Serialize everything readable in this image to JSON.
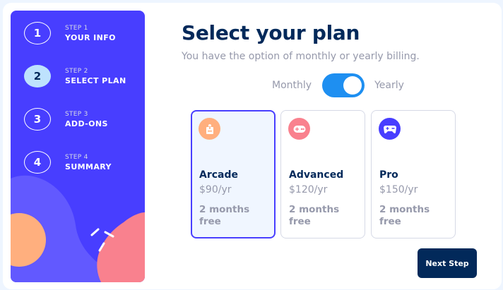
{
  "sidebar": {
    "steps": [
      {
        "number": "1",
        "sub": "STEP 1",
        "label": "YOUR INFO",
        "active": false
      },
      {
        "number": "2",
        "sub": "STEP 2",
        "label": "SELECT PLAN",
        "active": true
      },
      {
        "number": "3",
        "sub": "STEP 3",
        "label": "ADD-ONS",
        "active": false
      },
      {
        "number": "4",
        "sub": "STEP 4",
        "label": "SUMMARY",
        "active": false
      }
    ]
  },
  "main": {
    "title": "Select your plan",
    "subtitle": "You have the option of monthly or yearly billing.",
    "billing": {
      "monthly_label": "Monthly",
      "yearly_label": "Yearly",
      "selected": "Yearly"
    },
    "plans": [
      {
        "name": "Arcade",
        "price": "$90/yr",
        "promo": "2 months free",
        "icon": "arcade-icon",
        "icon_color": "#ffaf7e",
        "selected": true
      },
      {
        "name": "Advanced",
        "price": "$120/yr",
        "promo": "2 months free",
        "icon": "advanced-icon",
        "icon_color": "#f9818e",
        "selected": false
      },
      {
        "name": "Pro",
        "price": "$150/yr",
        "promo": "2 months free",
        "icon": "pro-icon",
        "icon_color": "#483eff",
        "selected": false
      }
    ],
    "next_label": "Next Step"
  },
  "colors": {
    "accent": "#483eff",
    "navy": "#02295a",
    "toggle": "#1e8ff1",
    "active_step": "#bee2fd",
    "muted": "#9699ab"
  }
}
